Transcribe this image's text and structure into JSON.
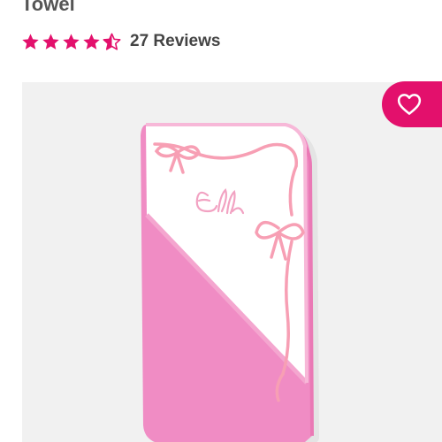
{
  "product": {
    "title": "Towel",
    "rating": 4.5,
    "rating_max": 5,
    "reviews_label": "27 Reviews"
  },
  "image": {
    "monogram": "Elle"
  },
  "icons": {
    "favorite": "heart-icon",
    "star": "star-icon"
  },
  "colors": {
    "accent": "#e3106c",
    "towel_pink": "#f08cc4",
    "ribbon_pink": "#f79fb4",
    "text": "#555555"
  }
}
